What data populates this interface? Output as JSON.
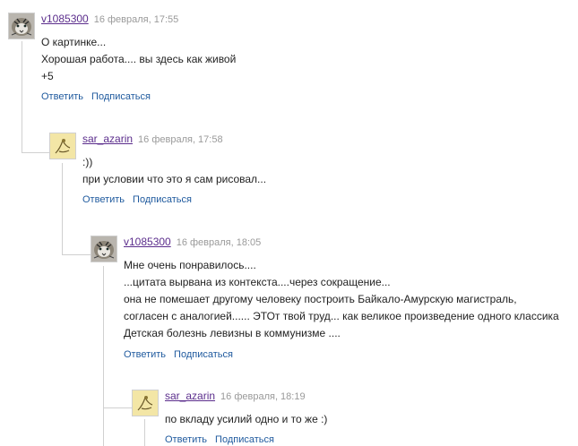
{
  "comments": [
    {
      "author": "v1085300",
      "date": "16 февраля, 17:55",
      "avatar": "tiger-avatar",
      "lines": [
        "О картинке...",
        "Хорошая работа.... вы здесь как живой",
        "+5"
      ],
      "reply": "Ответить",
      "subscribe": "Подписаться"
    },
    {
      "author": "sar_azarin",
      "date": "16 февраля, 17:58",
      "avatar": "sketch-avatar",
      "lines": [
        ":))",
        "при условии что это я сам рисовал..."
      ],
      "reply": "Ответить",
      "subscribe": "Подписаться"
    },
    {
      "author": "v1085300",
      "date": "16 февраля, 18:05",
      "avatar": "tiger-avatar",
      "lines": [
        "Мне очень понравилось....",
        "...цитата вырвана из контекста....через сокращение...",
        "она не помешает другому человеку построить Байкало-Амурскую магистраль,",
        "согласен с аналогией...... ЭТОт твой труд... как великое произведение одного классика",
        "Детская болезнь левизны в коммунизме ...."
      ],
      "reply": "Ответить",
      "subscribe": "Подписаться"
    },
    {
      "author": "sar_azarin",
      "date": "16 февраля, 18:19",
      "avatar": "sketch-avatar",
      "lines": [
        "по вкладу усилий одно и то же :)"
      ],
      "reply": "Ответить",
      "subscribe": "Подписаться"
    }
  ]
}
